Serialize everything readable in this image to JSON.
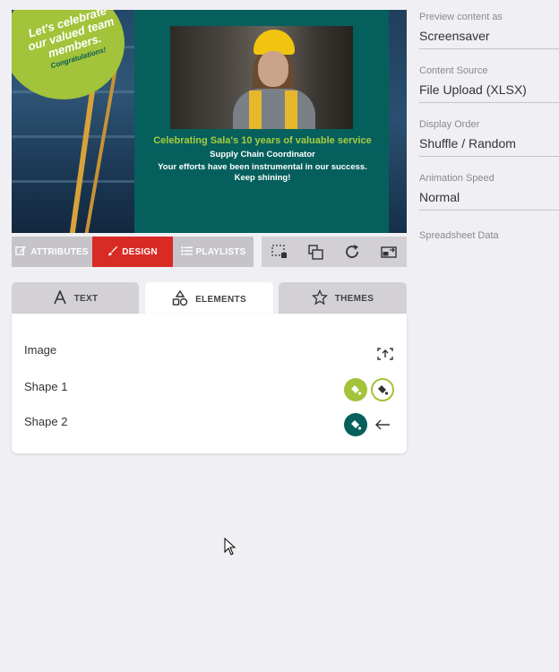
{
  "preview": {
    "badge_lines": [
      "Let's celebrate",
      "our valued team",
      "members."
    ],
    "badge_congrats": "Congratulations!",
    "headline": "Celebrating Sala's 10 years of valuable service",
    "role": "Supply Chain Coordinator",
    "message_line1": "Your efforts have been instrumental in our success.",
    "message_line2": "Keep shining!",
    "colors": {
      "background": "#05605d",
      "badge": "#a2c33a",
      "headline": "#a9cc3f"
    }
  },
  "toolbar": {
    "tabs": [
      {
        "label": "ATTRIBUTES",
        "icon": "edit-icon",
        "active": false
      },
      {
        "label": "DESIGN",
        "icon": "brush-icon",
        "active": true
      },
      {
        "label": "PLAYLISTS",
        "icon": "list-icon",
        "active": false
      }
    ],
    "actions": [
      "select-region-icon",
      "copy-icon",
      "refresh-icon",
      "swap-screen-icon"
    ],
    "active_color": "#d92b26"
  },
  "element_tabs": [
    {
      "label": "TEXT",
      "icon": "text-icon",
      "active": false
    },
    {
      "label": "ELEMENTS",
      "icon": "shapes-icon",
      "active": true
    },
    {
      "label": "THEMES",
      "icon": "star-icon",
      "active": false
    }
  ],
  "elements": [
    {
      "label": "Image",
      "actions": [
        "image-replace-icon"
      ]
    },
    {
      "label": "Shape 1",
      "actions": [
        "fill-color-icon",
        "fill-color-light-icon"
      ],
      "colors": [
        "#a2c33a",
        "#ffffff"
      ]
    },
    {
      "label": "Shape 2",
      "actions": [
        "fill-color-icon",
        "arrow-left-icon"
      ],
      "colors": [
        "#05605d"
      ]
    }
  ],
  "settings": [
    {
      "label": "Preview content as",
      "value": "Screensaver"
    },
    {
      "label": "Content Source",
      "value": "File Upload (XLSX)"
    },
    {
      "label": "Display Order",
      "value": "Shuffle / Random"
    },
    {
      "label": "Animation Speed",
      "value": "Normal"
    },
    {
      "label": "Spreadsheet Data",
      "value": ""
    }
  ]
}
